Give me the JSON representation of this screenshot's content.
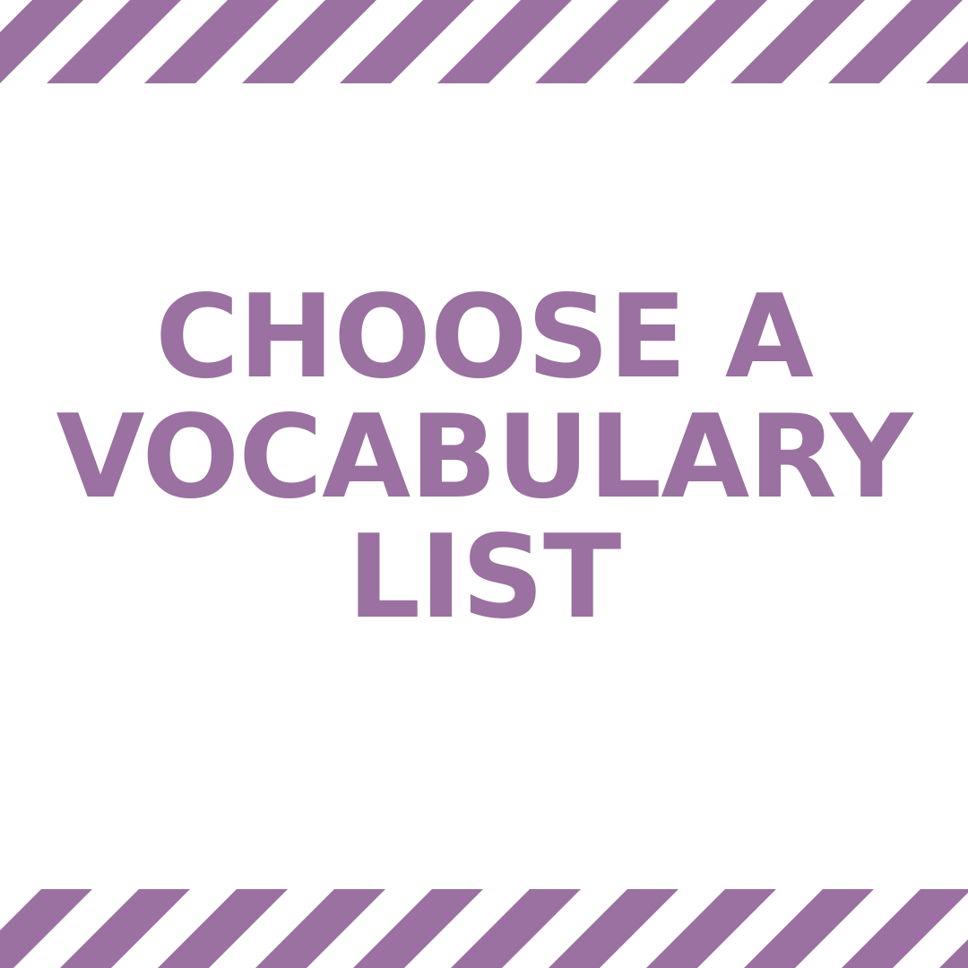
{
  "theme": {
    "accent_color": "#9a71a0",
    "background_color": "#ffffff"
  },
  "headline": {
    "lines": [
      "CHOOSE A",
      "VOCABULARY",
      "LIST"
    ]
  }
}
